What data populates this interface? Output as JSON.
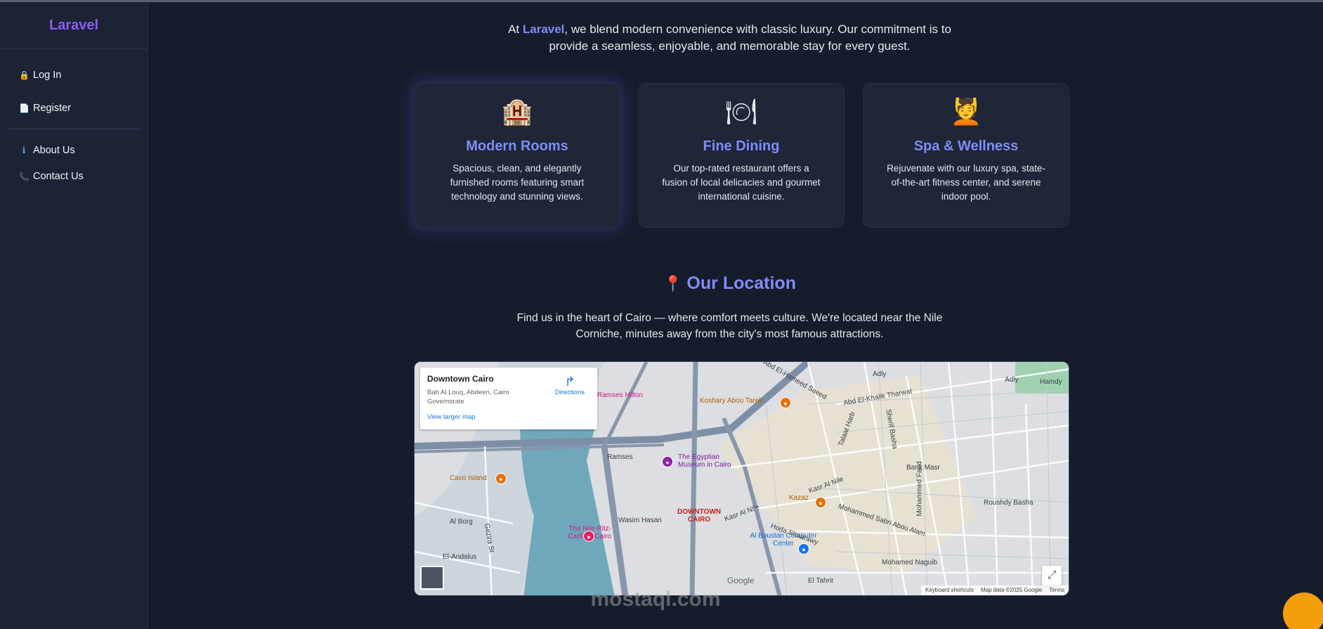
{
  "sidebar": {
    "brand": "Laravel",
    "items": [
      {
        "label": "Log In",
        "icon": "lock-icon"
      },
      {
        "label": "Register",
        "icon": "register-icon"
      },
      {
        "label": "About Us",
        "icon": "info-icon"
      },
      {
        "label": "Contact Us",
        "icon": "phone-icon"
      }
    ]
  },
  "intro": {
    "prefix": "At ",
    "highlight": "Laravel",
    "suffix": ", we blend modern convenience with classic luxury. Our commitment is to provide a seamless, enjoyable, and memorable stay for every guest."
  },
  "features": [
    {
      "title": "Modern Rooms",
      "icon": "hotel-icon",
      "description": "Spacious, clean, and elegantly furnished rooms featuring smart technology and stunning views."
    },
    {
      "title": "Fine Dining",
      "icon": "plate-icon",
      "description": "Our top-rated restaurant offers a fusion of local delicacies and gourmet international cuisine."
    },
    {
      "title": "Spa & Wellness",
      "icon": "spa-icon",
      "description": "Rejuvenate with our luxury spa, state-of-the-art fitness center, and serene indoor pool."
    }
  ],
  "location": {
    "title": "Our Location",
    "description": "Find us in the heart of Cairo — where comfort meets culture. We're located near the Nile Corniche, minutes away from the city's most famous attractions."
  },
  "map": {
    "place_name": "Downtown Cairo",
    "address": "Bab Al Louq, Abdeen, Cairo Governorate",
    "directions_label": "Directions",
    "larger_map_label": "View larger map",
    "labels": {
      "ramses_hilton": "Ramses Hilton",
      "koshary": "Koshary Abou Tarek",
      "egyptian_museum": "The Egyptian Museum in Cairo",
      "cavo_island": "Cavo Island",
      "downtown": "DOWNTOWN CAIRO",
      "ritz": "The Nile Ritz-Carlton, Cairo",
      "kazaz": "Kazaz",
      "boustan": "Al Boustan Computer Center",
      "ramses_st": "Ramses",
      "kasr_al_nile": "Kasr Al Nile",
      "kasr_al_nile_2": "Kasr Al Nile",
      "abd_el_khalik": "Abd El-Khalik Tharwat",
      "adly": "Adly",
      "hamdy": "Hamdy",
      "talaat_harb": "Talaat Harb",
      "sherif_basha": "Sherif Basha",
      "bank_masr": "Bank Masr",
      "roushdy_basha": "Roushdy Basha",
      "mohammed_sabri": "Mohammed Sabri Abou Alam",
      "mohamed_naguib": "Mohamed Naguib",
      "el_tahrir": "El Tahrir",
      "hoda_shaarawy": "Hoda Shaarawy",
      "al_borg": "Al Borg",
      "el_andalus": "El-Andalus",
      "wasim_hasan": "Wasim Hasan",
      "mohammed_farid": "Mohammed Farid",
      "gezira": "Gezira St",
      "abd_el_hameed": "Abd El-Hameed Saeed"
    },
    "google": "Google",
    "keyboard_shortcuts": "Keyboard shortcuts",
    "map_data": "Map data ©2025 Google",
    "terms": "Terms"
  },
  "watermark": "mostaql.com"
}
